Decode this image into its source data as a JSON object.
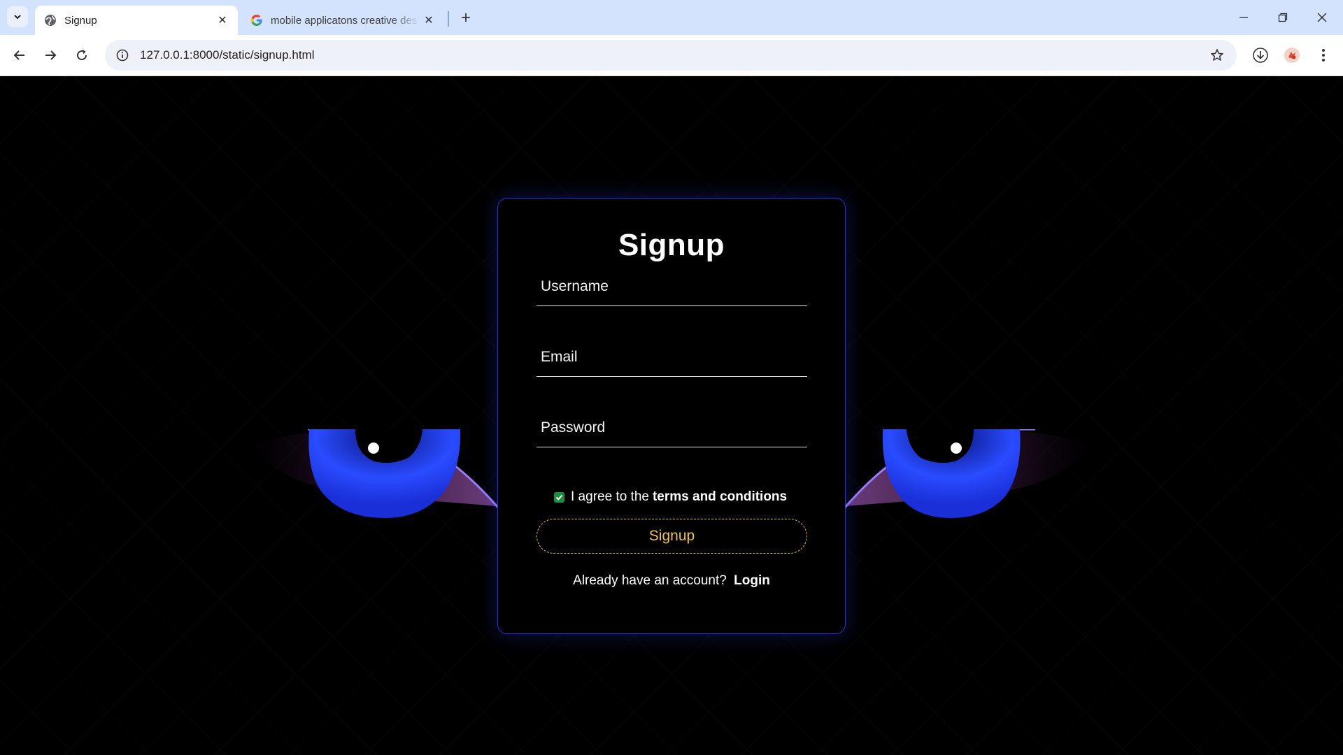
{
  "browser": {
    "tabs": [
      {
        "title": "Signup",
        "active": true
      },
      {
        "title": "mobile applicatons creative des",
        "active": false
      }
    ],
    "url": "127.0.0.1:8000/static/signup.html",
    "icons": [
      "tab-search-icon",
      "globe-icon",
      "google-icon",
      "close-icon",
      "plus-icon",
      "minimize-icon",
      "restore-icon",
      "window-close-icon",
      "back-icon",
      "forward-icon",
      "reload-icon",
      "site-info-icon",
      "star-icon",
      "download-icon",
      "extension-icon",
      "menu-icon"
    ]
  },
  "form": {
    "title": "Signup",
    "username_placeholder": "Username",
    "email_placeholder": "Email",
    "password_placeholder": "Password",
    "agree_prefix": "I agree to the",
    "agree_link": "terms and conditions",
    "agree_checked": true,
    "submit_label": "Signup",
    "login_prompt": "Already have an account?",
    "login_link": "Login"
  },
  "colors": {
    "card_border": "#2a2fd6",
    "button_border": "#e8b93a",
    "button_text": "#f2c24e",
    "eye_blue": "#2a4cff",
    "checkbox": "#1e8e3e"
  }
}
